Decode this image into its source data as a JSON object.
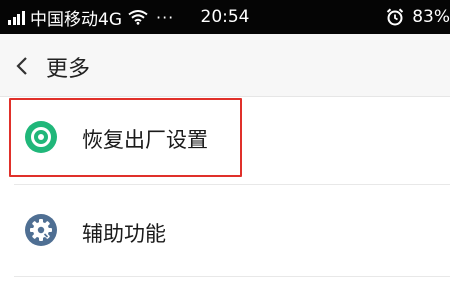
{
  "status_bar": {
    "carrier": "中国移动4G",
    "more": "···",
    "time": "20:54",
    "battery": "83%",
    "icons": [
      "signal-icon",
      "wifi-icon",
      "more-icon",
      "alarm-icon"
    ]
  },
  "header": {
    "title": "更多",
    "back_icon": "chevron-left-icon"
  },
  "list": {
    "items": [
      {
        "label": "恢复出厂设置",
        "icon": "reset-icon",
        "icon_color": "#20b77a",
        "highlighted": true
      },
      {
        "label": "辅助功能",
        "icon": "gear-icon",
        "icon_color": "#4f6f93",
        "highlighted": false
      }
    ]
  },
  "colors": {
    "status_bar_bg": "#050505",
    "header_bg": "#f7f7f7",
    "highlight_border": "#e0302a",
    "text": "#1a1a1a"
  }
}
